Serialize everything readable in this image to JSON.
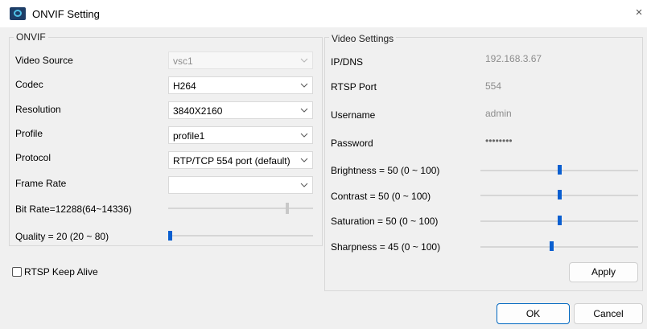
{
  "window": {
    "title": "ONVIF Setting",
    "close_icon": "×"
  },
  "onvif": {
    "group_title": "ONVIF",
    "video_source": {
      "label": "Video Source",
      "value": "vsc1"
    },
    "codec": {
      "label": "Codec",
      "value": "H264"
    },
    "resolution": {
      "label": "Resolution",
      "value": "3840X2160"
    },
    "profile": {
      "label": "Profile",
      "value": "profile1"
    },
    "protocol": {
      "label": "Protocol",
      "value": "RTP/TCP 554 port (default)"
    },
    "frame_rate": {
      "label": "Frame Rate",
      "value": ""
    },
    "bit_rate": {
      "label": "Bit Rate=12288(64~14336)",
      "level": 0.83
    },
    "quality": {
      "label": "Quality = 20 (20 ~ 80)",
      "level": 0.0
    }
  },
  "rtsp_keep_alive": {
    "label": "RTSP Keep Alive",
    "checked": false
  },
  "video_settings": {
    "group_title": "Video Settings",
    "ip_dns": {
      "label": "IP/DNS",
      "value": "192.168.3.67"
    },
    "rtsp_port": {
      "label": "RTSP Port",
      "value": "554"
    },
    "username": {
      "label": "Username",
      "value": "admin"
    },
    "password": {
      "label": "Password",
      "value": "••••••••"
    },
    "brightness": {
      "label": "Brightness = 50 (0 ~ 100)",
      "value": 50
    },
    "contrast": {
      "label": "Contrast = 50 (0 ~ 100)",
      "value": 50
    },
    "saturation": {
      "label": "Saturation = 50 (0 ~ 100)",
      "value": 50
    },
    "sharpness": {
      "label": "Sharpness = 45 (0 ~ 100)",
      "value": 45
    },
    "apply_label": "Apply"
  },
  "footer": {
    "ok_label": "OK",
    "cancel_label": "Cancel"
  }
}
